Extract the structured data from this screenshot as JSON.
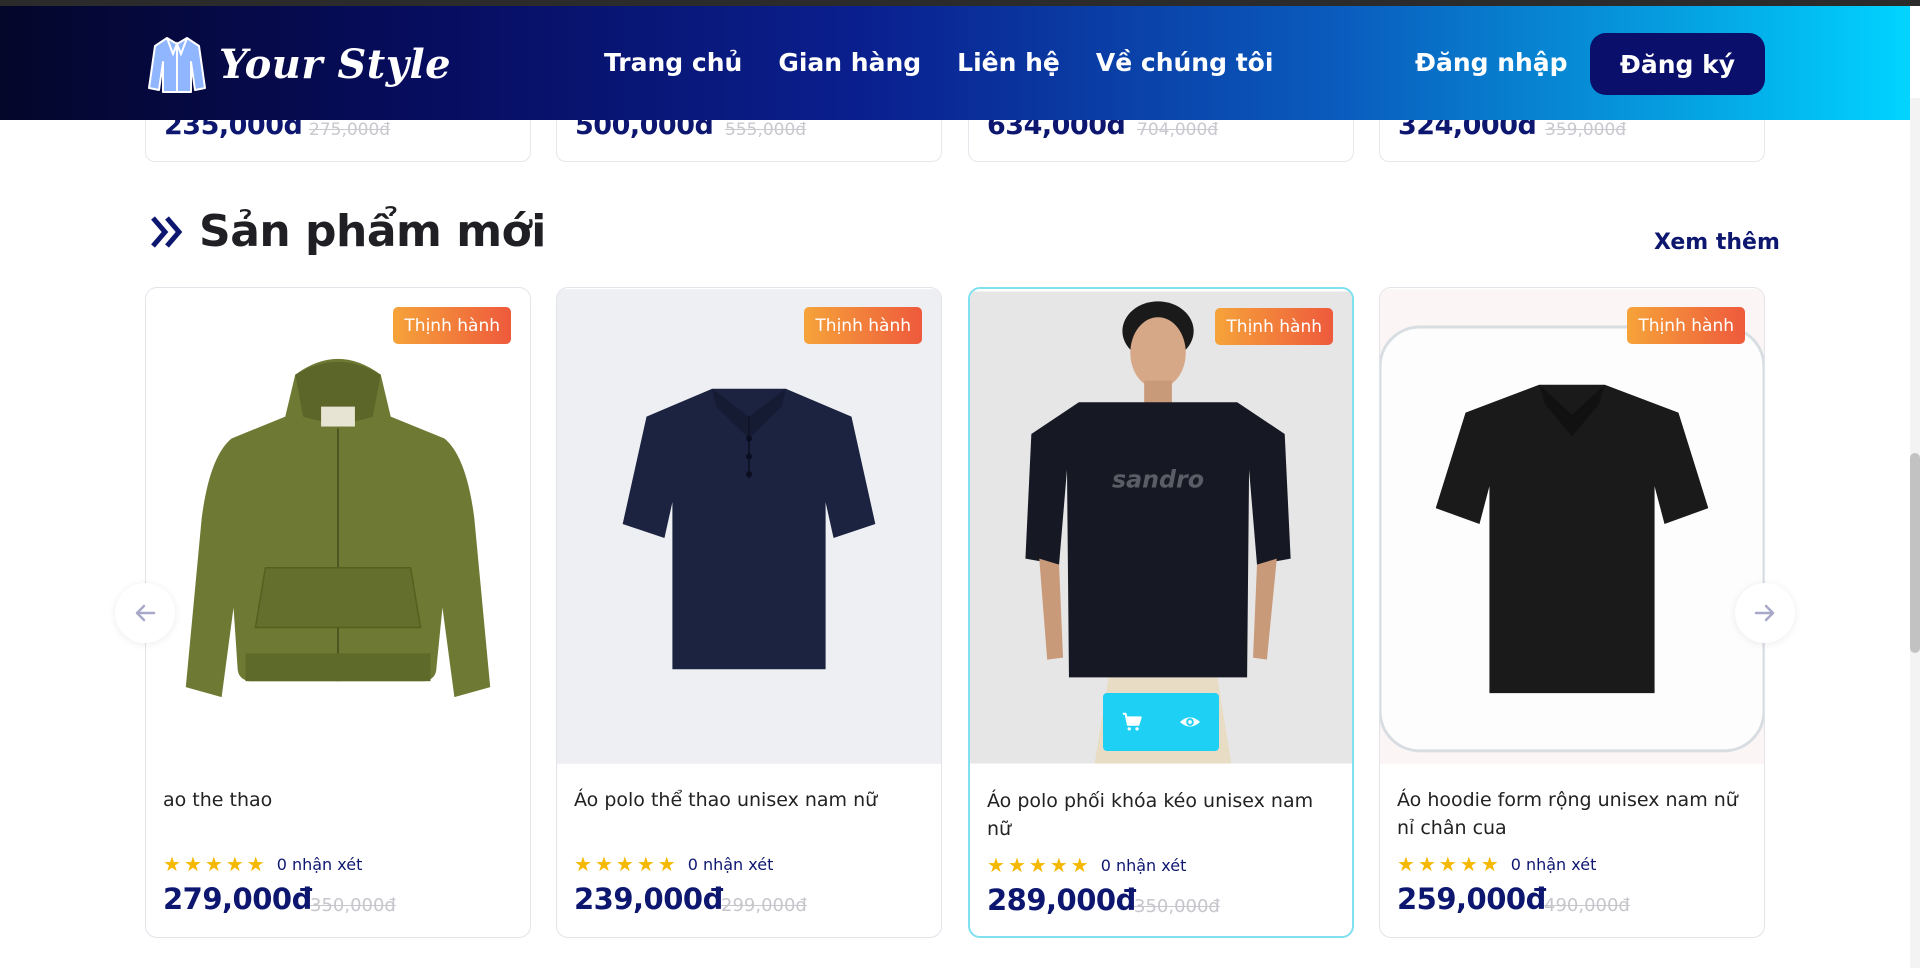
{
  "header": {
    "brand": "Your Style",
    "nav": [
      {
        "label": "Trang chủ"
      },
      {
        "label": "Gian hàng"
      },
      {
        "label": "Liên hệ"
      },
      {
        "label": "Về chúng tôi"
      }
    ],
    "login_label": "Đăng nhập",
    "register_label": "Đăng ký"
  },
  "previous_row": [
    {
      "price": "235,000đ",
      "old_price": "275,000đ"
    },
    {
      "price": "500,000đ",
      "old_price": "555,000đ"
    },
    {
      "price": "634,000đ",
      "old_price": "704,000đ"
    },
    {
      "price": "324,000đ",
      "old_price": "359,000đ"
    }
  ],
  "section": {
    "title": "Sản phẩm mới",
    "see_more": "Xem thêm"
  },
  "products": [
    {
      "badge": "Thịnh hành",
      "name": "ao the thao",
      "rating": 5,
      "reviews": "0 nhận xét",
      "price": "279,000đ",
      "old_price": "350,000đ",
      "image": "olive-zip-hoodie"
    },
    {
      "badge": "Thịnh hành",
      "name": "Áo polo thể thao unisex nam nữ",
      "rating": 5,
      "reviews": "0 nhận xét",
      "price": "239,000đ",
      "old_price": "299,000đ",
      "image": "navy-knit-polo"
    },
    {
      "badge": "Thịnh hành",
      "name": "Áo polo phối khóa kéo unisex nam nữ",
      "rating": 5,
      "reviews": "0 nhận xét",
      "price": "289,000đ",
      "old_price": "350,000đ",
      "image": "model-black-tee",
      "tee_print": "sandro"
    },
    {
      "badge": "Thịnh hành",
      "name": "Áo hoodie form rộng unisex nam nữ nỉ chân cua",
      "rating": 5,
      "reviews": "0 nhận xét",
      "price": "259,000đ",
      "old_price": "490,000đ",
      "image": "black-polo"
    }
  ],
  "icons": {
    "cart": "cart-icon",
    "view": "eye-icon",
    "prev": "arrow-left-icon",
    "next": "arrow-right-icon"
  },
  "colors": {
    "brand_dark": "#0d1770",
    "accent_cyan": "#1fd0f5",
    "star": "#f5b800",
    "badge_start": "#f6a33a",
    "badge_end": "#ee5a3c"
  }
}
